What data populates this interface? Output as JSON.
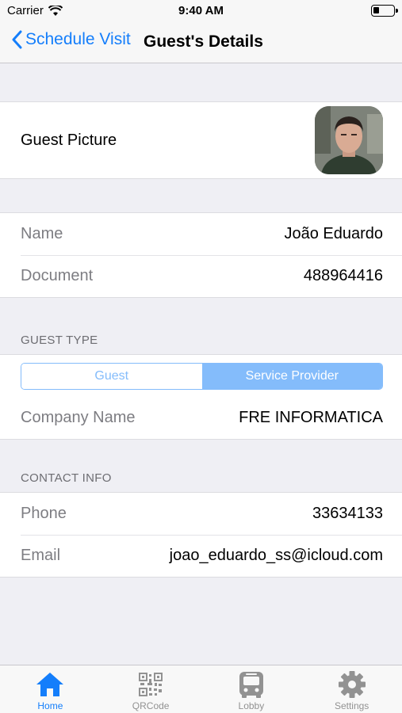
{
  "status_bar": {
    "carrier": "Carrier",
    "time": "9:40 AM"
  },
  "nav": {
    "back_label": "Schedule Visit",
    "title": "Guest's Details"
  },
  "picture_section": {
    "label": "Guest Picture"
  },
  "details": {
    "name_label": "Name",
    "name_value": "João Eduardo",
    "document_label": "Document",
    "document_value": "488964416"
  },
  "guest_type": {
    "header": "GUEST TYPE",
    "segments": [
      "Guest",
      "Service Provider"
    ],
    "selected": "Service Provider",
    "company_label": "Company Name",
    "company_value": "FRE INFORMATICA"
  },
  "contact": {
    "header": "CONTACT INFO",
    "phone_label": "Phone",
    "phone_value": "33634133",
    "email_label": "Email",
    "email_value": "joao_eduardo_ss@icloud.com"
  },
  "tabs": [
    {
      "label": "Home",
      "icon": "home-icon",
      "active": true
    },
    {
      "label": "QRCode",
      "icon": "qrcode-icon",
      "active": false
    },
    {
      "label": "Lobby",
      "icon": "bus-icon",
      "active": false
    },
    {
      "label": "Settings",
      "icon": "gear-icon",
      "active": false
    }
  ],
  "colors": {
    "accent": "#147efb",
    "segment": "#84bcfb",
    "background": "#efeff4"
  }
}
